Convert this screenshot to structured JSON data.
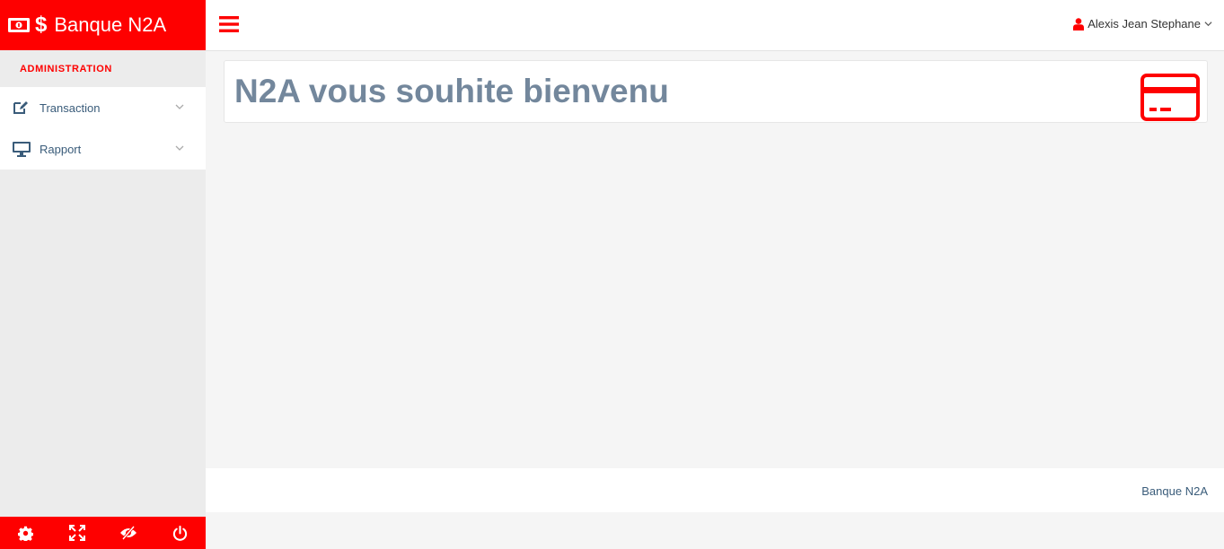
{
  "brand": {
    "name": "Banque N2A",
    "dollar": "$",
    "icon": "money-icon"
  },
  "sidebar": {
    "section_title": "ADMINISTRATION",
    "items": [
      {
        "label": "Transaction",
        "icon": "edit-icon"
      },
      {
        "label": "Rapport",
        "icon": "desktop-icon"
      }
    ],
    "footer_buttons": [
      "gear-icon",
      "fullscreen-icon",
      "eye-slash-icon",
      "power-icon"
    ]
  },
  "header": {
    "menu_icon": "hamburger-icon",
    "user_name": "Alexis Jean Stephane",
    "user_icon": "user-icon"
  },
  "main": {
    "welcome_text": "N2A vous souhite bienvenu",
    "card_icon": "credit-card-icon"
  },
  "footer": {
    "text": "Banque N2A"
  },
  "colors": {
    "accent": "#fe0000",
    "title": "#73879c",
    "link": "#3a5c7a"
  }
}
